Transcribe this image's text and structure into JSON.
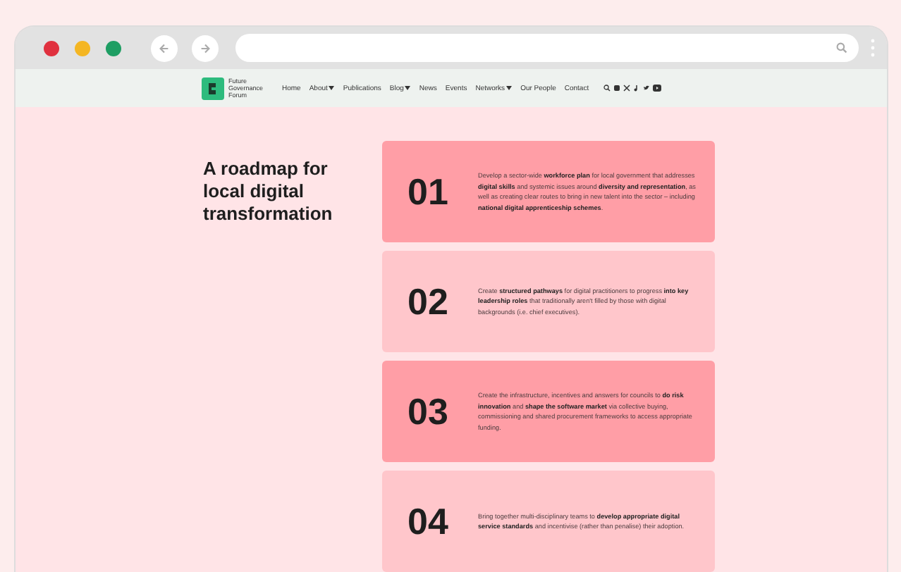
{
  "brand": {
    "name": "Future Governance Forum"
  },
  "nav": [
    {
      "label": "Home",
      "has_dropdown": false
    },
    {
      "label": "About",
      "has_dropdown": true
    },
    {
      "label": "Publications",
      "has_dropdown": false
    },
    {
      "label": "Blog",
      "has_dropdown": true
    },
    {
      "label": "News",
      "has_dropdown": false
    },
    {
      "label": "Events",
      "has_dropdown": false
    },
    {
      "label": "Networks",
      "has_dropdown": true
    },
    {
      "label": "Our People",
      "has_dropdown": false
    },
    {
      "label": "Contact",
      "has_dropdown": false
    }
  ],
  "heading": "A roadmap for local digital transformation",
  "cards": [
    {
      "number": "01",
      "color": "#ff9ea6",
      "text": "Develop a sector-wide **workforce plan** for local government that addresses **digital skills** and systemic issues around **diversity and representation**, as well as creating clear routes to bring in new talent into the sector – including **national digital apprenticeship schemes**."
    },
    {
      "number": "02",
      "color": "#ffc6cb",
      "text": "Create **structured pathways** for digital practitioners to progress **into key leadership roles** that traditionally aren't filled by those with digital backgrounds (i.e. chief executives)."
    },
    {
      "number": "03",
      "color": "#ff9ea6",
      "text": "Create the infrastructure, incentives and answers for councils to **do risk innovation** and **shape the software market** via collective buying, commissioning and shared procurement frameworks to access appropriate funding."
    },
    {
      "number": "04",
      "color": "#ffc6cb",
      "text": "Bring together multi-disciplinary teams to **develop appropriate digital service standards** and incentivise (rather than penalise) their adoption."
    }
  ]
}
